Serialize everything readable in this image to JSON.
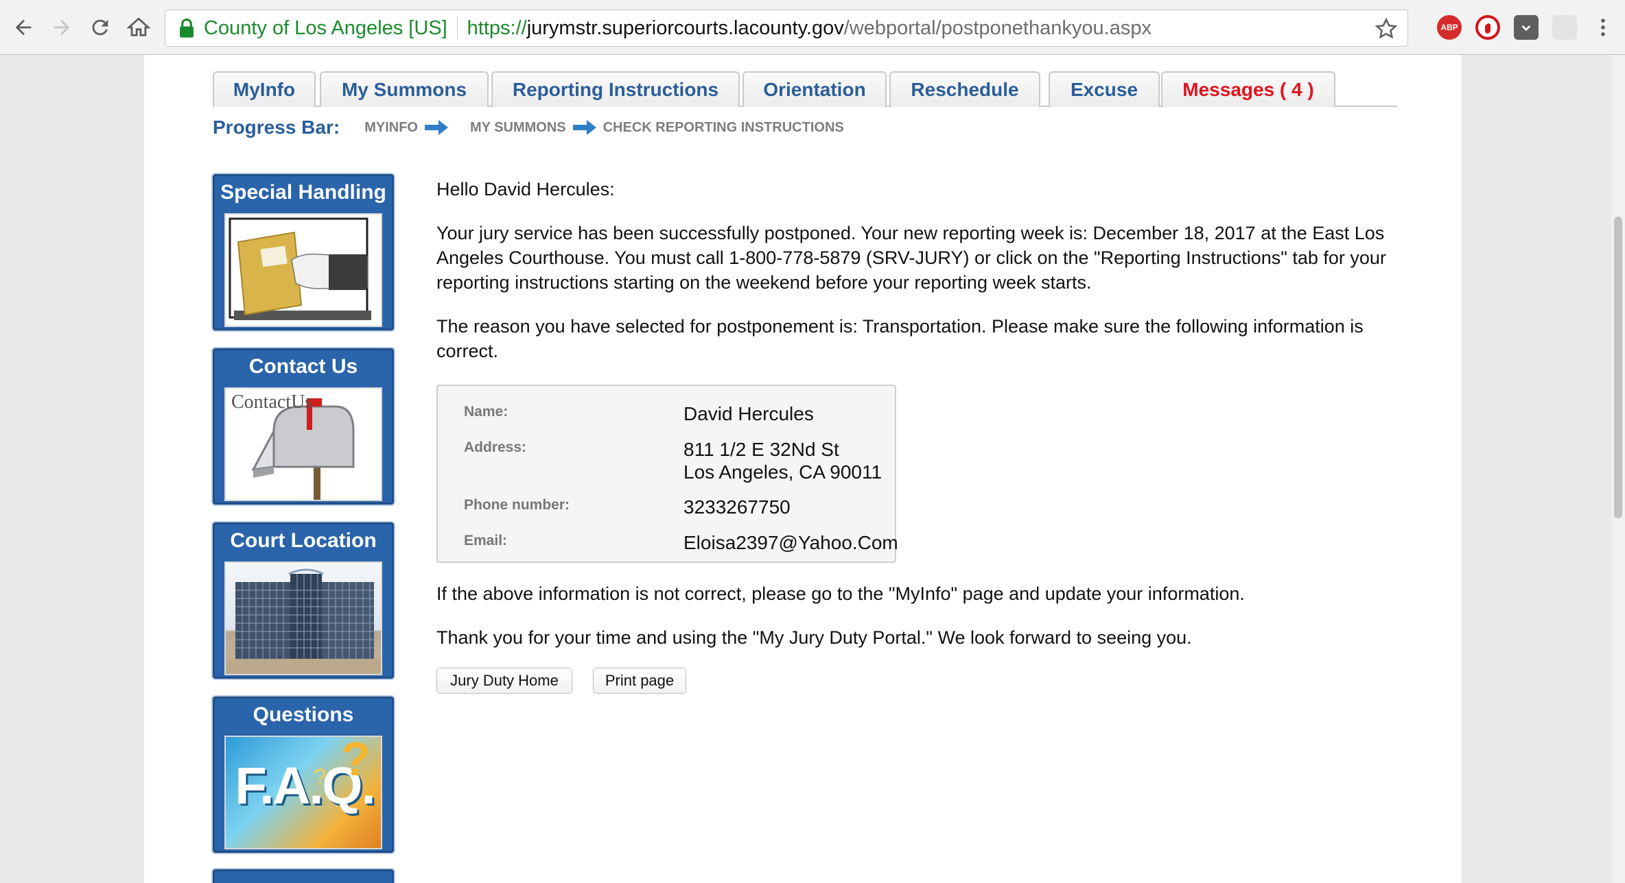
{
  "browser": {
    "site_identity": "County of Los Angeles [US]",
    "url_scheme": "https://",
    "url_host": "jurymstr.superiorcourts.lacounty.gov",
    "url_path": "/webportal/postponethankyou.aspx",
    "extensions": [
      "ABP",
      "ublock",
      "pocket",
      "chat"
    ]
  },
  "tabs": [
    {
      "label": "MyInfo"
    },
    {
      "label": "My Summons"
    },
    {
      "label": "Reporting Instructions"
    },
    {
      "label": "Orientation"
    },
    {
      "label": "Reschedule"
    },
    {
      "label": "Excuse"
    },
    {
      "label": "Messages ( 4 )"
    }
  ],
  "progress": {
    "label": "Progress Bar:",
    "steps": [
      "MYINFO",
      "MY SUMMONS",
      "CHECK REPORTING INSTRUCTIONS"
    ]
  },
  "sidebar": {
    "cards": [
      {
        "title": "Special Handling"
      },
      {
        "title": "Contact Us",
        "image_text": "ContactUs"
      },
      {
        "title": "Court Location"
      },
      {
        "title": "Questions",
        "image_text": "F.A.Q."
      }
    ]
  },
  "main": {
    "greeting": "Hello David Hercules:",
    "confirmation": "Your jury service has been successfully postponed. Your new reporting week is: December 18, 2017 at the East Los Angeles Courthouse. You must call 1-800-778-5879 (SRV-JURY) or click on the \"Reporting Instructions\" tab for your reporting instructions starting on the weekend before your reporting week starts.",
    "reason": "The reason you have selected for postponement is: Transportation. Please make sure the following information is correct.",
    "info": {
      "name_label": "Name:",
      "name": "David Hercules",
      "address_label": "Address:",
      "address_line1": "811 1/2 E 32Nd St",
      "address_line2": "Los Angeles, CA 90011",
      "phone_label": "Phone number:",
      "phone": "3233267750",
      "email_label": "Email:",
      "email": "Eloisa2397@Yahoo.Com"
    },
    "correction_note": "If the above information is not correct, please go to the \"MyInfo\" page and update your information.",
    "thanks": "Thank you for your time and using the \"My Jury Duty Portal.\" We look forward to seeing you.",
    "home_button": "Jury Duty Home",
    "print_button": "Print page"
  },
  "colors": {
    "tab_text": "#2a5e9a",
    "messages_tab": "#e0141e",
    "card_background": "#2a64aa",
    "secure_green": "#1b8a2c"
  }
}
